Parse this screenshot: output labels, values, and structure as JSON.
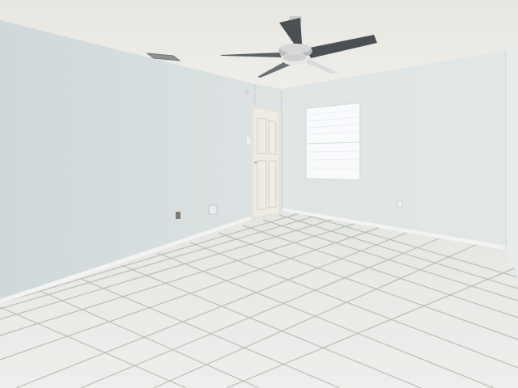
{
  "scene": {
    "subject": "empty-room",
    "colors": {
      "ceiling": "#ecebe6",
      "left_wall": "#d3dcdd",
      "back_wall": "#dfe4e4",
      "right_wall": "#e6eaea",
      "floor_tile": "#e8eae7",
      "grout": "#b9bdb8",
      "baseboard": "#f4f5f3",
      "door": "#eeece4",
      "window_glass": "#f7f9fb",
      "fan_blade": "#4b5055",
      "fan_body": "#c9cbcc"
    }
  }
}
